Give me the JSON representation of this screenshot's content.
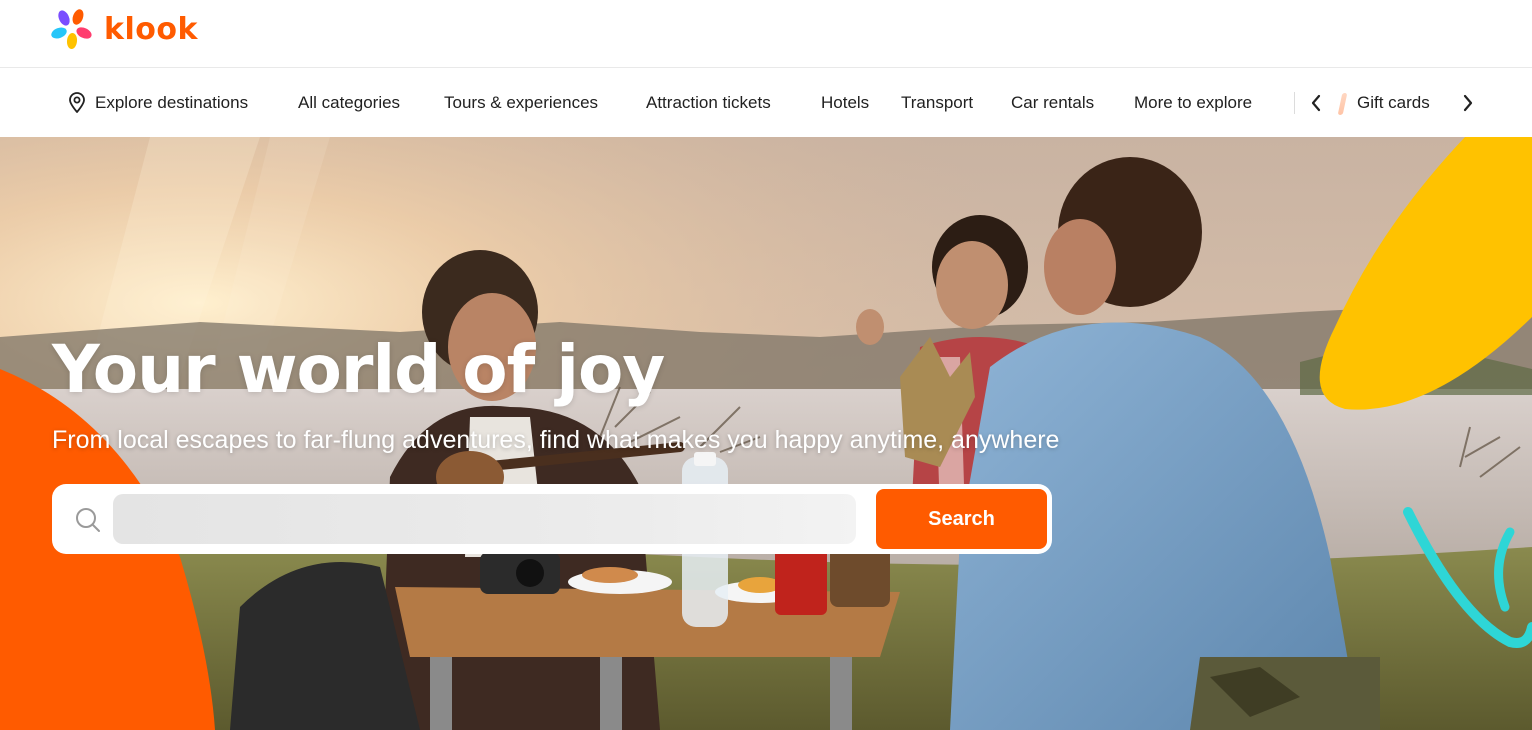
{
  "brand": {
    "name": "klook",
    "color": "#ff5b00",
    "logo_icon": "klook-petal-logo"
  },
  "nav": {
    "items": [
      {
        "label": "Explore destinations",
        "icon": "location-pin-icon"
      },
      {
        "label": "All categories"
      },
      {
        "label": "Tours & experiences"
      },
      {
        "label": "Attraction tickets"
      },
      {
        "label": "Hotels"
      },
      {
        "label": "Transport"
      },
      {
        "label": "Car rentals"
      },
      {
        "label": "More to explore"
      }
    ],
    "carousel": {
      "prev_icon": "chevron-left-icon",
      "next_icon": "chevron-right-icon",
      "item_label": "Gift cards"
    }
  },
  "hero": {
    "title": "Your world of joy",
    "subtitle": "From local escapes to far-flung adventures, find what makes you happy anytime, anywhere",
    "search": {
      "icon": "search-icon",
      "value": "",
      "placeholder": "",
      "button_label": "Search"
    },
    "colors": {
      "accent_orange": "#ff5b00",
      "accent_yellow": "#ffc200",
      "accent_teal": "#2ed6d6"
    }
  }
}
